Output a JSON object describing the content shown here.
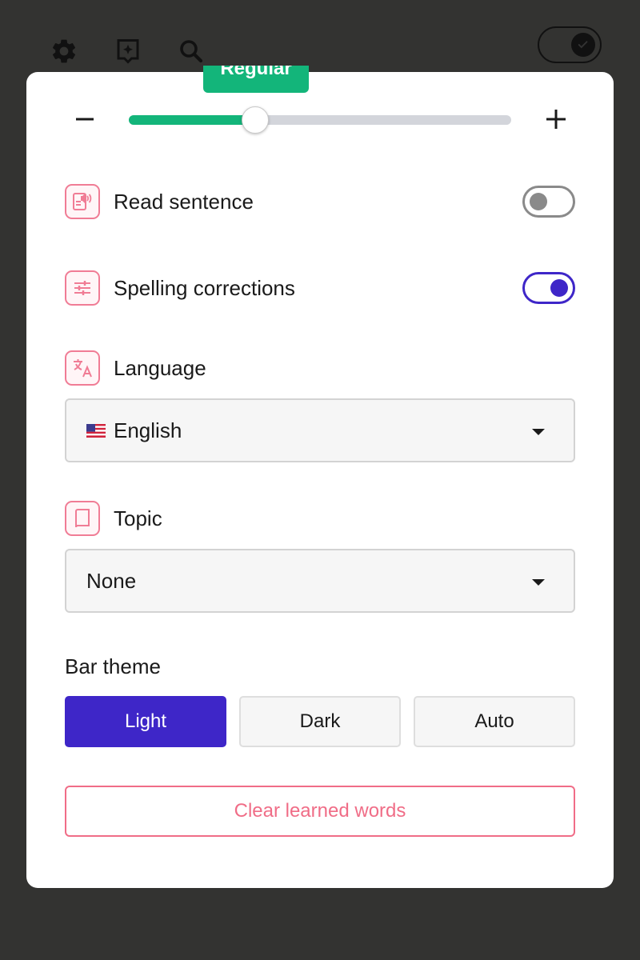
{
  "toolbar": {
    "icons": [
      "gear-icon",
      "sparkle-bookmark-icon",
      "search-icon"
    ],
    "dark_mode_toggle": true
  },
  "text_size": {
    "label": "Regular",
    "value": 0.33,
    "minus_icon": "minus-icon",
    "plus_icon": "plus-icon"
  },
  "settings": {
    "read_sentence": {
      "label": "Read sentence",
      "icon": "speaker-document-icon",
      "enabled": false
    },
    "spelling_corrections": {
      "label": "Spelling corrections",
      "icon": "sliders-icon",
      "enabled": true
    },
    "language": {
      "label": "Language",
      "icon": "translate-icon",
      "selected": "English",
      "flag_icon": "us-flag-icon"
    },
    "topic": {
      "label": "Topic",
      "icon": "book-icon",
      "selected": "None"
    }
  },
  "bar_theme": {
    "label": "Bar theme",
    "options": [
      "Light",
      "Dark",
      "Auto"
    ],
    "selected": "Light"
  },
  "clear_button": {
    "label": "Clear learned words"
  },
  "colors": {
    "accent_green": "#13b57a",
    "accent_purple": "#3e26c8",
    "accent_pink": "#f06d87",
    "background": "#333331"
  }
}
